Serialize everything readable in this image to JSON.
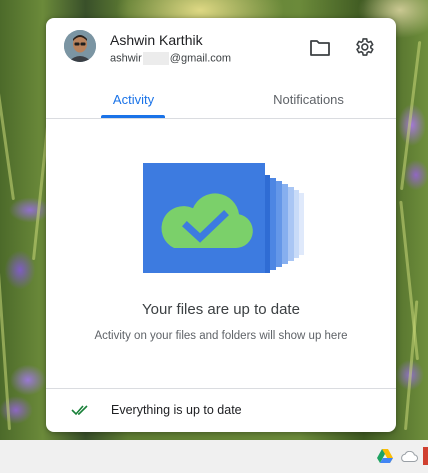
{
  "account": {
    "name": "Ashwin Karthik",
    "email_user": "ashwir",
    "email_domain": "@gmail.com"
  },
  "toolbar": {
    "folder_icon": "folder-icon",
    "settings_icon": "gear-icon"
  },
  "tabs": [
    {
      "label": "Activity",
      "active": true
    },
    {
      "label": "Notifications",
      "active": false
    }
  ],
  "status": {
    "headline": "Your files are up to date",
    "description": "Activity on your files and folders will show up here",
    "footer_text": "Everything is up to date"
  },
  "colors": {
    "accent": "#1a73e8",
    "cloud_green": "#7bd06a",
    "doc_blue": "#3d7be0",
    "check_green": "#188038"
  },
  "taskbar": {
    "tray_icons": [
      "google-drive-icon",
      "cloud-icon"
    ]
  }
}
